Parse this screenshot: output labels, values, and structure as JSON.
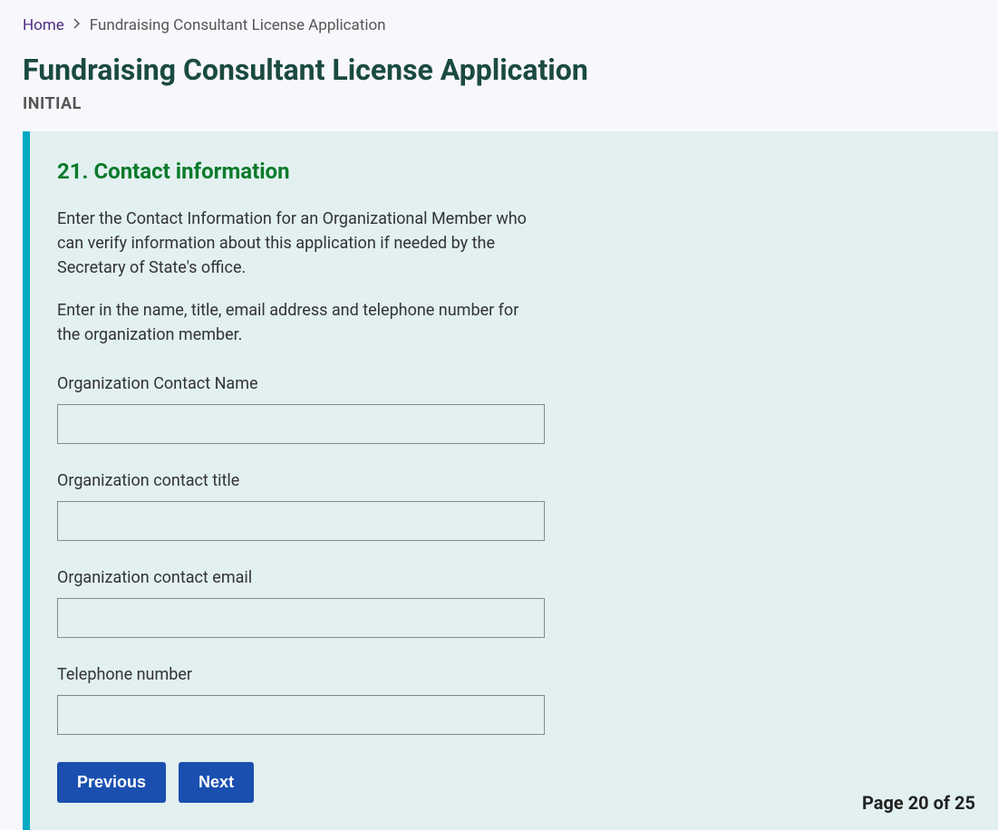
{
  "breadcrumb": {
    "home_label": "Home",
    "current": "Fundraising Consultant License Application"
  },
  "header": {
    "title": "Fundraising Consultant License Application",
    "subtitle": "INITIAL"
  },
  "section": {
    "title": "21. Contact information",
    "desc1": "Enter the Contact Information for an Organizational Member who can verify information about this application if needed by the Secretary of State's office.",
    "desc2": "Enter in the name, title, email address and telephone number for the organization member."
  },
  "fields": {
    "contact_name": {
      "label": "Organization Contact Name",
      "value": ""
    },
    "contact_title": {
      "label": "Organization contact title",
      "value": ""
    },
    "contact_email": {
      "label": "Organization contact email",
      "value": ""
    },
    "telephone": {
      "label": "Telephone number",
      "value": ""
    }
  },
  "buttons": {
    "previous": "Previous",
    "next": "Next"
  },
  "pagination": {
    "text": "Page 20 of 25"
  }
}
